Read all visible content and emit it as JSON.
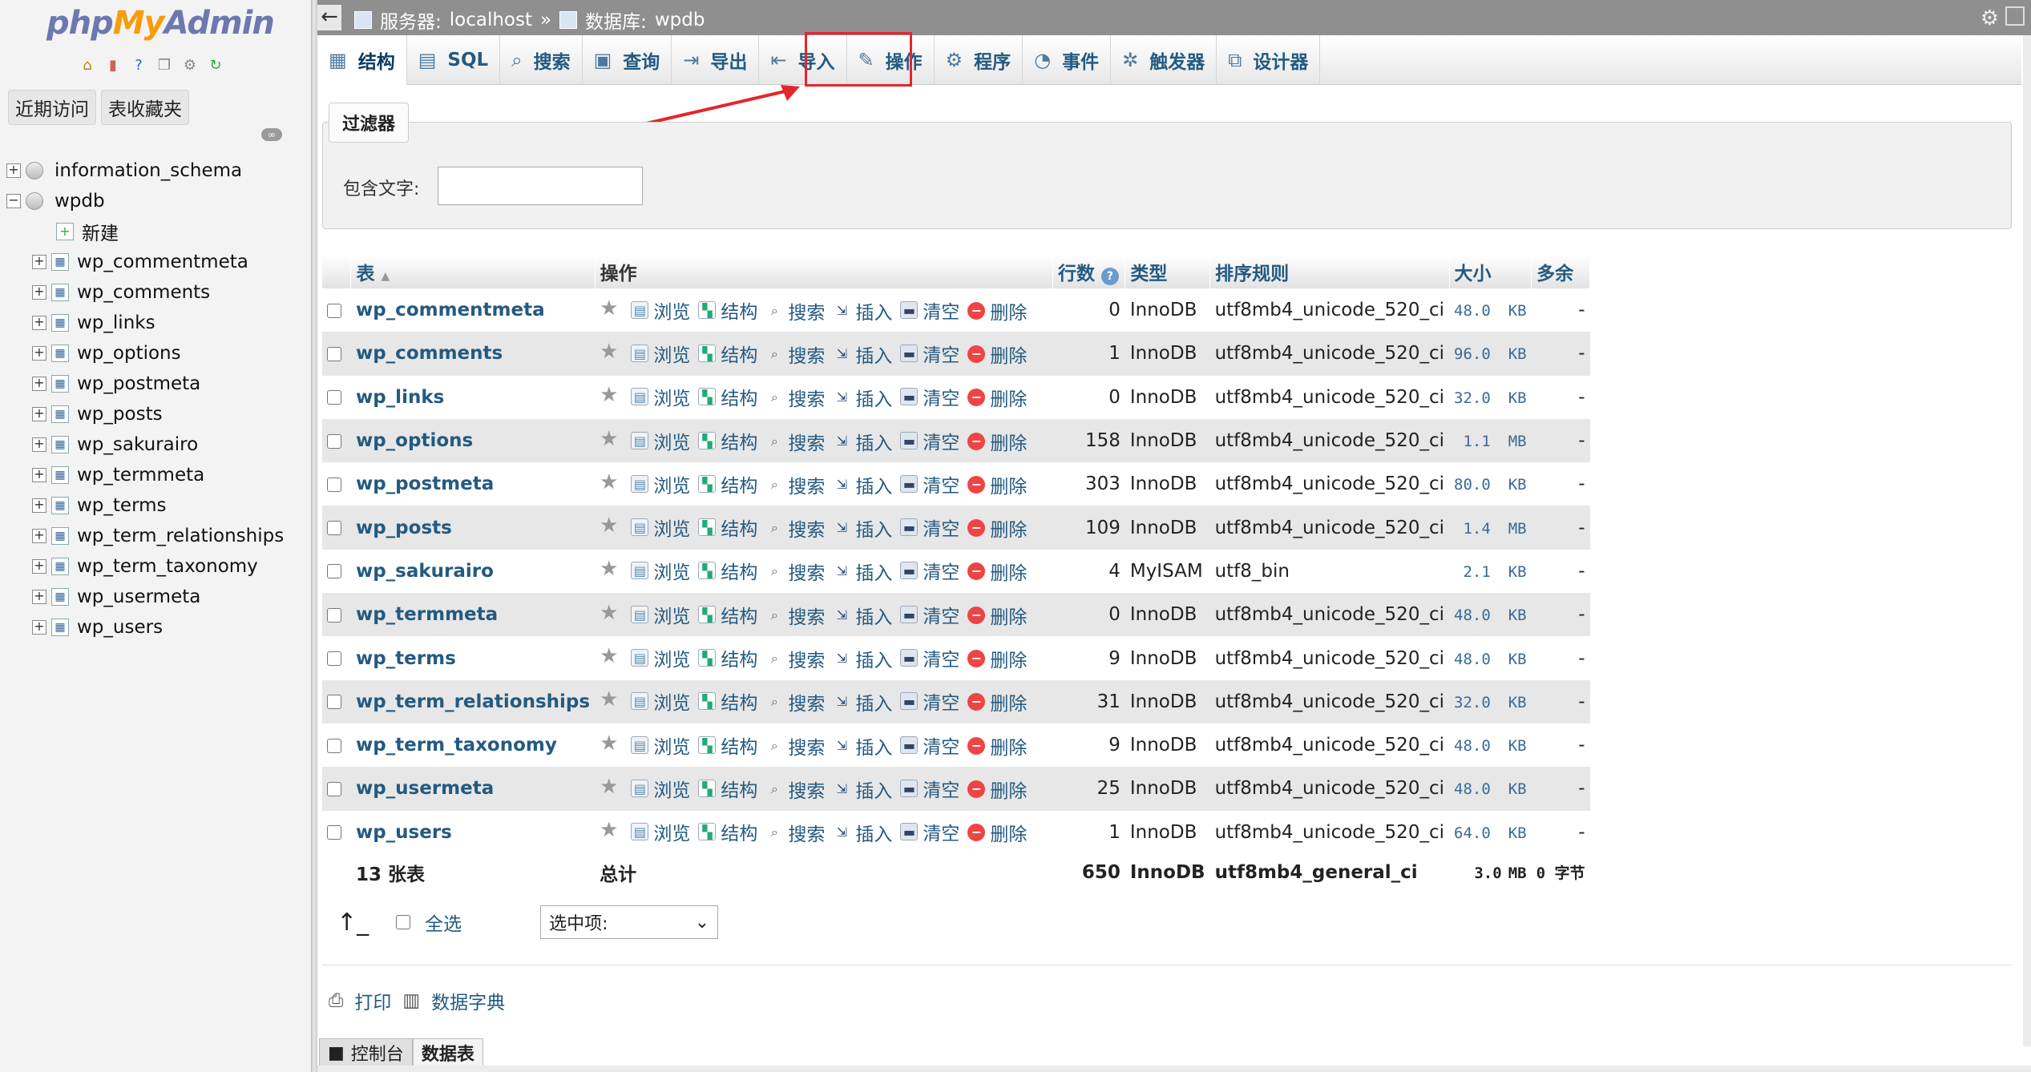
{
  "left": {
    "logo": {
      "php": "php",
      "my": "My",
      "admin": "Admin"
    },
    "tabs": [
      "近期访问",
      "表收藏夹"
    ],
    "tree": {
      "dbs": [
        {
          "name": "information_schema",
          "expand": "+"
        },
        {
          "name": "wpdb",
          "expand": "−"
        }
      ],
      "new_label": "新建",
      "tables": [
        "wp_commentmeta",
        "wp_comments",
        "wp_links",
        "wp_options",
        "wp_postmeta",
        "wp_posts",
        "wp_sakurairo",
        "wp_termmeta",
        "wp_terms",
        "wp_term_relationships",
        "wp_term_taxonomy",
        "wp_usermeta",
        "wp_users"
      ]
    }
  },
  "breadcrumb": {
    "server_label": "服务器:",
    "server": "localhost",
    "sep": "»",
    "db_label": "数据库:",
    "db": "wpdb"
  },
  "tabs": [
    {
      "icon": "structure-icon",
      "glyph": "▦",
      "label": "结构"
    },
    {
      "icon": "sql-icon",
      "glyph": "▤",
      "label": "SQL"
    },
    {
      "icon": "search-icon",
      "glyph": "⌕",
      "label": "搜索"
    },
    {
      "icon": "query-icon",
      "glyph": "▣",
      "label": "查询"
    },
    {
      "icon": "export-icon",
      "glyph": "⇥",
      "label": "导出"
    },
    {
      "icon": "import-icon",
      "glyph": "⇤",
      "label": "导入"
    },
    {
      "icon": "wrench-icon",
      "glyph": "✎",
      "label": "操作"
    },
    {
      "icon": "routines-icon",
      "glyph": "⚙",
      "label": "程序"
    },
    {
      "icon": "clock-icon",
      "glyph": "◔",
      "label": "事件"
    },
    {
      "icon": "triggers-icon",
      "glyph": "✲",
      "label": "触发器"
    },
    {
      "icon": "designer-icon",
      "glyph": "⧉",
      "label": "设计器"
    }
  ],
  "filter": {
    "legend": "过滤器",
    "label": "包含文字:",
    "value": ""
  },
  "table": {
    "headers": {
      "name": "表",
      "actions": "操作",
      "rows": "行数",
      "type": "类型",
      "collation": "排序规则",
      "size": "大小",
      "overhead": "多余"
    },
    "action_labels": {
      "browse": "浏览",
      "structure": "结构",
      "search": "搜索",
      "insert": "插入",
      "empty": "清空",
      "drop": "删除"
    },
    "rows": [
      {
        "name": "wp_commentmeta",
        "rows": "0",
        "type": "InnoDB",
        "collation": "utf8mb4_unicode_520_ci",
        "size": "48.0",
        "unit": "KB",
        "overhead": "-"
      },
      {
        "name": "wp_comments",
        "rows": "1",
        "type": "InnoDB",
        "collation": "utf8mb4_unicode_520_ci",
        "size": "96.0",
        "unit": "KB",
        "overhead": "-"
      },
      {
        "name": "wp_links",
        "rows": "0",
        "type": "InnoDB",
        "collation": "utf8mb4_unicode_520_ci",
        "size": "32.0",
        "unit": "KB",
        "overhead": "-"
      },
      {
        "name": "wp_options",
        "rows": "158",
        "type": "InnoDB",
        "collation": "utf8mb4_unicode_520_ci",
        "size": "1.1",
        "unit": "MB",
        "overhead": "-"
      },
      {
        "name": "wp_postmeta",
        "rows": "303",
        "type": "InnoDB",
        "collation": "utf8mb4_unicode_520_ci",
        "size": "80.0",
        "unit": "KB",
        "overhead": "-"
      },
      {
        "name": "wp_posts",
        "rows": "109",
        "type": "InnoDB",
        "collation": "utf8mb4_unicode_520_ci",
        "size": "1.4",
        "unit": "MB",
        "overhead": "-"
      },
      {
        "name": "wp_sakurairo",
        "rows": "4",
        "type": "MyISAM",
        "collation": "utf8_bin",
        "size": "2.1",
        "unit": "KB",
        "overhead": "-"
      },
      {
        "name": "wp_termmeta",
        "rows": "0",
        "type": "InnoDB",
        "collation": "utf8mb4_unicode_520_ci",
        "size": "48.0",
        "unit": "KB",
        "overhead": "-"
      },
      {
        "name": "wp_terms",
        "rows": "9",
        "type": "InnoDB",
        "collation": "utf8mb4_unicode_520_ci",
        "size": "48.0",
        "unit": "KB",
        "overhead": "-"
      },
      {
        "name": "wp_term_relationships",
        "rows": "31",
        "type": "InnoDB",
        "collation": "utf8mb4_unicode_520_ci",
        "size": "32.0",
        "unit": "KB",
        "overhead": "-"
      },
      {
        "name": "wp_term_taxonomy",
        "rows": "9",
        "type": "InnoDB",
        "collation": "utf8mb4_unicode_520_ci",
        "size": "48.0",
        "unit": "KB",
        "overhead": "-"
      },
      {
        "name": "wp_usermeta",
        "rows": "25",
        "type": "InnoDB",
        "collation": "utf8mb4_unicode_520_ci",
        "size": "48.0",
        "unit": "KB",
        "overhead": "-"
      },
      {
        "name": "wp_users",
        "rows": "1",
        "type": "InnoDB",
        "collation": "utf8mb4_unicode_520_ci",
        "size": "64.0",
        "unit": "KB",
        "overhead": "-"
      }
    ],
    "footer": {
      "count": "13 张表",
      "total_label": "总计",
      "rows": "650",
      "type": "InnoDB",
      "collation": "utf8mb4_general_ci",
      "size": "3.0",
      "unit": "MB",
      "overhead": "0 字节"
    }
  },
  "bottom": {
    "select_all": "全选",
    "with_selected": "选中项:",
    "print": "打印",
    "dict": "数据字典"
  },
  "console": {
    "console_label": "控制台",
    "data_label": "数据表"
  },
  "colors": {
    "link": "#235a81",
    "highlight": "#e3262e",
    "row_alt": "#e7e7e7"
  }
}
